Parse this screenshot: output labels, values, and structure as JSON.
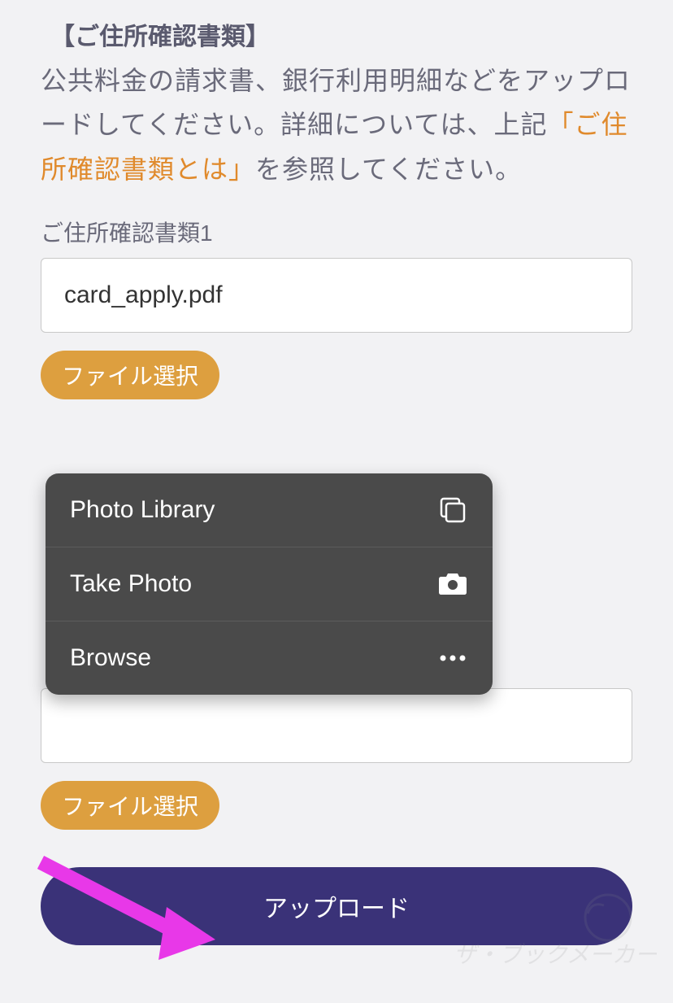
{
  "section": {
    "title": "【ご住所確認書類】",
    "description_part1": "公共料金の請求書、銀行利用明細などをアップロードしてください。詳細については、上記",
    "link_text": "「ご住所確認書類とは」",
    "description_part2": "を参照してください。"
  },
  "field1": {
    "label": "ご住所確認書類1",
    "value": "card_apply.pdf",
    "select_button": "ファイル選択"
  },
  "popup": {
    "items": [
      {
        "label": "Photo Library",
        "icon": "photo-library-icon"
      },
      {
        "label": "Take Photo",
        "icon": "camera-icon"
      },
      {
        "label": "Browse",
        "icon": "more-icon"
      }
    ]
  },
  "field2": {
    "select_button": "ファイル選択"
  },
  "upload_button": "アップロード",
  "watermark_text": "ザ・ブックメーカーズ"
}
